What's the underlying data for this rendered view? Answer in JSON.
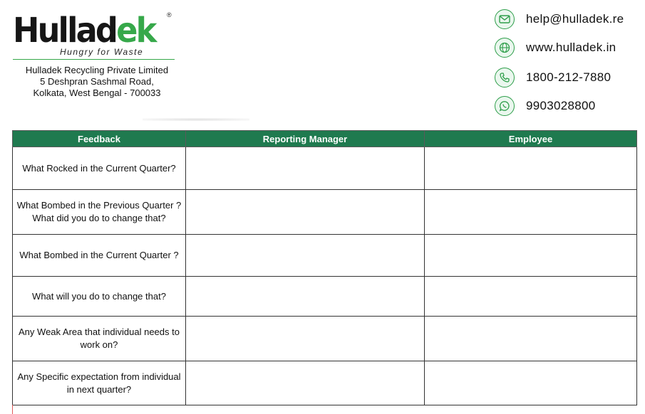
{
  "header": {
    "logo": {
      "wordmark_main": "Hullad",
      "wordmark_accent": "ek",
      "registered": "®",
      "tagline": "Hungry for Waste"
    },
    "address": {
      "line1": "Hulladek Recycling Private Limited",
      "line2": "5 Deshpran Sashmal Road,",
      "line3": "Kolkata, West Bengal - 700033"
    },
    "contacts": [
      {
        "icon": "mail-icon",
        "text": "help@hulladek.re"
      },
      {
        "icon": "globe-icon",
        "text": "www.hulladek.in"
      },
      {
        "icon": "phone-icon",
        "text": "1800-212-7880"
      },
      {
        "icon": "whatsapp-icon",
        "text": "9903028800"
      }
    ]
  },
  "colors": {
    "brand_green": "#36a84a",
    "header_green": "#1f7a4f"
  },
  "table": {
    "columns": [
      "Feedback",
      "Reporting Manager",
      "Employee"
    ],
    "rows": [
      {
        "question": "What Rocked in the Current Quarter?",
        "manager": "",
        "employee": ""
      },
      {
        "question": "What Bombed in the Previous Quarter ? What did you do to change that?",
        "manager": "",
        "employee": ""
      },
      {
        "question": "What Bombed in the Current Quarter ?",
        "manager": "",
        "employee": ""
      },
      {
        "question": "What will you do to change that?",
        "manager": "",
        "employee": ""
      },
      {
        "question": "Any Weak Area that individual needs to work on?",
        "manager": "",
        "employee": ""
      },
      {
        "question": "Any Specific expectation from individual in next quarter?",
        "manager": "",
        "employee": ""
      }
    ]
  }
}
